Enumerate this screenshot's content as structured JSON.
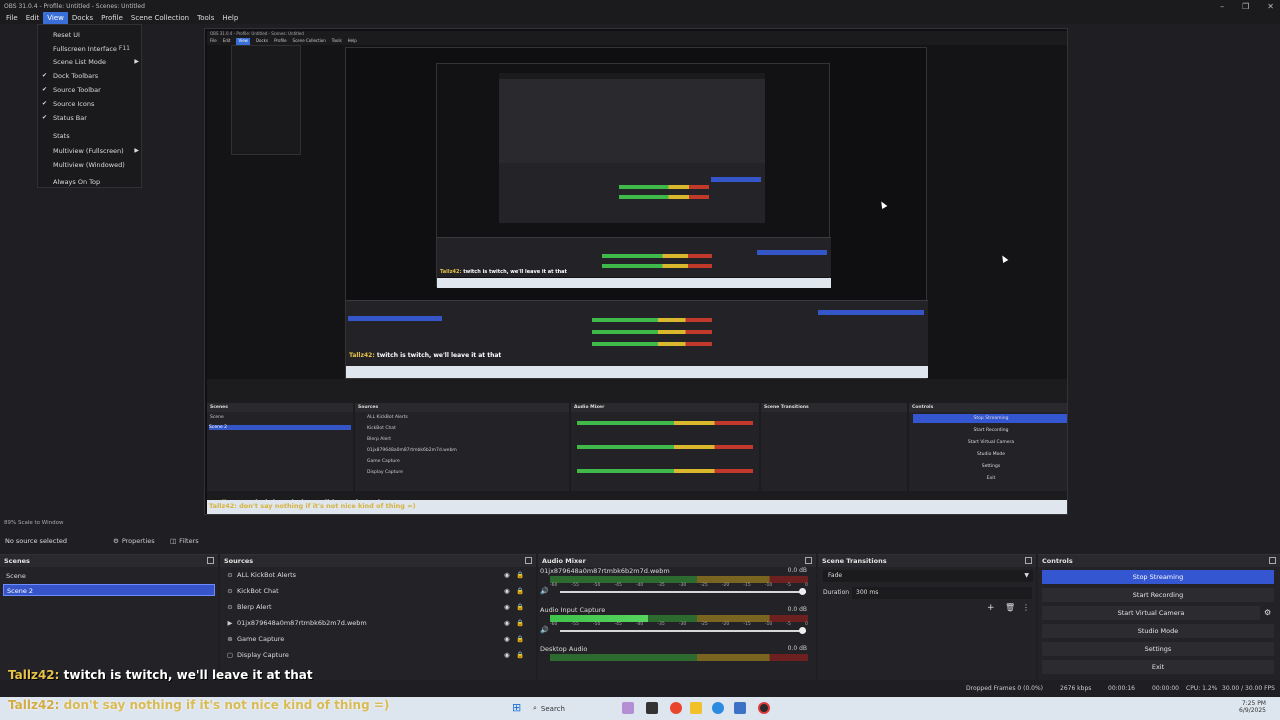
{
  "window": {
    "title": "OBS 31.0.4 - Profile: Untitled - Scenes: Untitled"
  },
  "menubar": [
    "File",
    "Edit",
    "View",
    "Docks",
    "Profile",
    "Scene Collection",
    "Tools",
    "Help"
  ],
  "view_menu": {
    "items": [
      {
        "label": "Reset UI",
        "check": "",
        "shortcut": "",
        "arrow": ""
      },
      {
        "label": "Fullscreen Interface",
        "check": "",
        "shortcut": "F11",
        "arrow": ""
      },
      {
        "label": "Scene List Mode",
        "check": "",
        "shortcut": "",
        "arrow": "▶"
      },
      {
        "label": "Dock Toolbars",
        "check": "✔",
        "shortcut": "",
        "arrow": ""
      },
      {
        "label": "Source Toolbar",
        "check": "✔",
        "shortcut": "",
        "arrow": ""
      },
      {
        "label": "Source Icons",
        "check": "✔",
        "shortcut": "",
        "arrow": ""
      },
      {
        "label": "Status Bar",
        "check": "✔",
        "shortcut": "",
        "arrow": ""
      },
      {
        "label": "Stats",
        "check": "",
        "shortcut": "",
        "arrow": ""
      },
      {
        "label": "Multiview (Fullscreen)",
        "check": "",
        "shortcut": "",
        "arrow": "▶"
      },
      {
        "label": "Multiview (Windowed)",
        "check": "",
        "shortcut": "",
        "arrow": ""
      },
      {
        "label": "Always On Top",
        "check": "",
        "shortcut": "",
        "arrow": ""
      }
    ]
  },
  "preview_status": "89%   Scale to Window",
  "toolbar": {
    "no_source": "No source selected",
    "properties": "Properties",
    "filters": "Filters"
  },
  "scenes": {
    "title": "Scenes",
    "items": [
      "Scene",
      "Scene 2"
    ],
    "selected": 1
  },
  "sources": {
    "title": "Sources",
    "items": [
      {
        "icon": "⊙",
        "label": "ALL KickBot Alerts"
      },
      {
        "icon": "⊙",
        "label": "KickBot Chat"
      },
      {
        "icon": "⊙",
        "label": "Blerp Alert"
      },
      {
        "icon": "▶",
        "label": "01jx879648a0m87rtmbk6b2m7d.webm"
      },
      {
        "icon": "⊛",
        "label": "Game Capture"
      },
      {
        "icon": "▢",
        "label": "Display Capture"
      }
    ]
  },
  "audio_mixer": {
    "title": "Audio Mixer",
    "ticks": [
      "-60",
      "-55",
      "-50",
      "-45",
      "-40",
      "-35",
      "-30",
      "-25",
      "-20",
      "-15",
      "-10",
      "-5",
      "0"
    ],
    "channels": [
      {
        "name": "01jx879648a0m87rtmbk6b2m7d.webm",
        "db": "0.0 dB",
        "level": 0
      },
      {
        "name": "Audio Input Capture",
        "db": "0.0 dB",
        "level": 0.38
      },
      {
        "name": "Desktop Audio",
        "db": "0.0 dB",
        "level": 0
      }
    ]
  },
  "scene_transitions": {
    "title": "Scene Transitions",
    "type": "Fade",
    "duration_label": "Duration",
    "duration": "300 ms"
  },
  "controls": {
    "title": "Controls",
    "buttons": [
      "Stop Streaming",
      "Start Recording",
      "Start Virtual Camera",
      "Studio Mode",
      "Settings",
      "Exit"
    ]
  },
  "chat": {
    "line1_user": "Tallz42:",
    "line1_text": " twitch is twitch, we'll leave it at that",
    "line2_user": "Tallz42:",
    "line2_text": " don't say nothing if it's not nice kind of thing =)"
  },
  "statusbar": {
    "dropped": "Dropped Frames 0 (0.0%)",
    "kbps": "2676 kbps",
    "live": "00:00:16",
    "rec": "00:00:00",
    "cpu": "CPU: 1.2%",
    "fps": "30.00 / 30.00 FPS"
  },
  "taskbar": {
    "search": "Search",
    "time": "7:25 PM",
    "date": "6/9/2025"
  },
  "nested": {
    "title": "OBS 31.0.4 - Profile: Untitled - Scenes: Untitled",
    "menu": [
      "File",
      "Edit",
      "View",
      "Docks",
      "Profile",
      "Scene Collection",
      "Tools",
      "Help"
    ],
    "scenes_title": "Scenes",
    "sources_title": "Sources",
    "mixer_title": "Audio Mixer",
    "trans_title": "Scene Transitions",
    "controls_title": "Controls",
    "scene_items": [
      "Scene",
      "Scene 2"
    ],
    "source_items": [
      "ALL KickBot Alerts",
      "KickBot Chat",
      "Blerp Alert",
      "01jx879648a0m87rtmbk6b2m7d.webm",
      "Game Capture",
      "Display Capture"
    ],
    "control_items": [
      "Stop Streaming",
      "Start Recording",
      "Start Virtual Camera",
      "Studio Mode",
      "Settings",
      "Exit"
    ],
    "chat_line": "twitch is twitch, we'll leave it at that",
    "chat_user": "Tallz42:",
    "chat2": "Tallz42: don't say nothing if it's not nice kind of thing =)"
  }
}
